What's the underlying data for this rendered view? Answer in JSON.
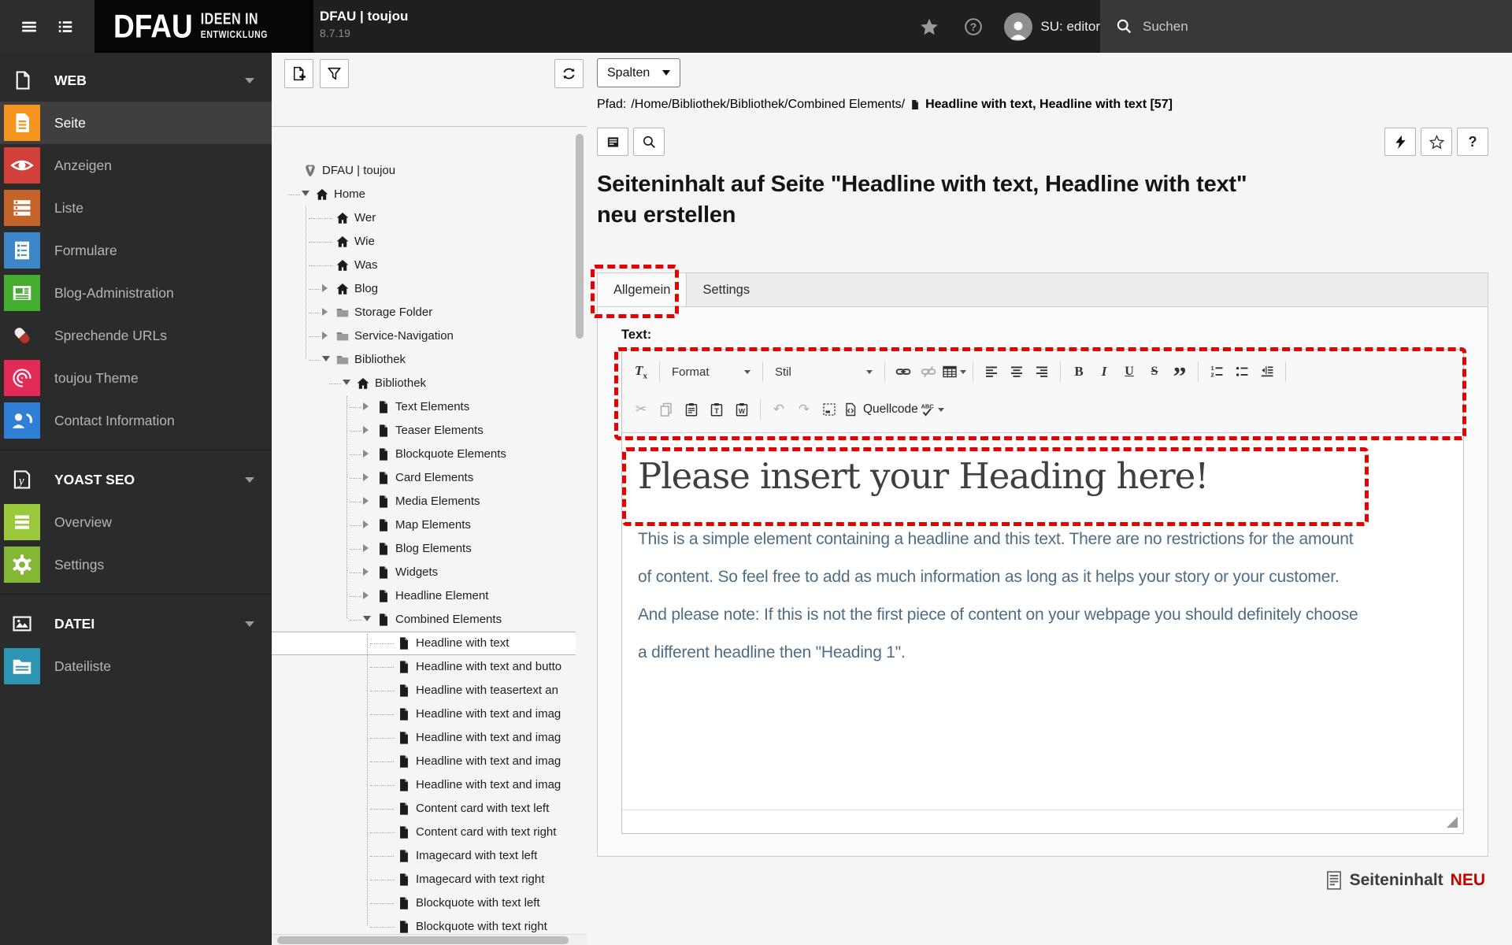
{
  "colors": {
    "annotation": "#e60000",
    "topbar_bg": "#1f1f1f",
    "sidebar_bg": "#2b2b2b",
    "rte_text_blue": "#4e6d87",
    "neu_red": "#c20000"
  },
  "topbar": {
    "logo_main": "DFAU",
    "logo_sub1": "IDEEN IN",
    "logo_sub2": "ENTWICKLUNG",
    "site_title": "DFAU | toujou",
    "version": "8.7.19",
    "username": "SU: editor",
    "search_label": "Suchen"
  },
  "sidebar": {
    "sections": [
      {
        "header": {
          "label": "WEB",
          "icon": "doc-outline"
        },
        "items": [
          {
            "label": "Seite",
            "icon": "mod-seite",
            "color": "#f7941d",
            "selected": true
          },
          {
            "label": "Anzeigen",
            "icon": "mod-eye",
            "color": "#d2403a"
          },
          {
            "label": "Liste",
            "icon": "mod-liste",
            "color": "#c4632a"
          },
          {
            "label": "Formulare",
            "icon": "mod-form",
            "color": "#3d87c8"
          },
          {
            "label": "Blog-Administration",
            "icon": "mod-news",
            "color": "#44ad2f"
          },
          {
            "label": "Sprechende URLs",
            "icon": "mod-pill",
            "color": ""
          },
          {
            "label": "toujou Theme",
            "icon": "mod-fingerprint",
            "color": "#e22b57"
          },
          {
            "label": "Contact Information",
            "icon": "mod-contact",
            "color": "#2f7fd6"
          }
        ]
      },
      {
        "header": {
          "label": "YOAST SEO",
          "icon": "mod-yoast"
        },
        "items": [
          {
            "label": "Overview",
            "icon": "mod-bars",
            "color": "#9aca3c"
          },
          {
            "label": "Settings",
            "icon": "mod-gear",
            "color": "#83b735"
          }
        ]
      },
      {
        "header": {
          "label": "DATEI",
          "icon": "image-outline"
        },
        "items": [
          {
            "label": "Dateiliste",
            "icon": "mod-files",
            "color": "#2e94b4"
          }
        ]
      }
    ]
  },
  "pagetree": {
    "nodes": [
      {
        "label": "DFAU | toujou",
        "level": 0,
        "icon": "typo3",
        "exp": null
      },
      {
        "label": "Home",
        "level": 1,
        "icon": "home",
        "exp": "down"
      },
      {
        "label": "Wer",
        "level": 2,
        "icon": "home",
        "exp": null
      },
      {
        "label": "Wie",
        "level": 2,
        "icon": "home",
        "exp": null
      },
      {
        "label": "Was",
        "level": 2,
        "icon": "home",
        "exp": null
      },
      {
        "label": "Blog",
        "level": 2,
        "icon": "home",
        "exp": "right"
      },
      {
        "label": "Storage Folder",
        "level": 2,
        "icon": "folder",
        "exp": "right"
      },
      {
        "label": "Service-Navigation",
        "level": 2,
        "icon": "folder",
        "exp": "right"
      },
      {
        "label": "Bibliothek",
        "level": 2,
        "icon": "folder",
        "exp": "down"
      },
      {
        "label": "Bibliothek",
        "level": 3,
        "icon": "home",
        "exp": "down"
      },
      {
        "label": "Text Elements",
        "level": 4,
        "icon": "page",
        "exp": "right"
      },
      {
        "label": "Teaser Elements",
        "level": 4,
        "icon": "page",
        "exp": "right"
      },
      {
        "label": "Blockquote Elements",
        "level": 4,
        "icon": "page",
        "exp": "right"
      },
      {
        "label": "Card Elements",
        "level": 4,
        "icon": "page",
        "exp": "right"
      },
      {
        "label": "Media Elements",
        "level": 4,
        "icon": "page",
        "exp": "right"
      },
      {
        "label": "Map Elements",
        "level": 4,
        "icon": "page",
        "exp": "right"
      },
      {
        "label": "Blog Elements",
        "level": 4,
        "icon": "page",
        "exp": "right"
      },
      {
        "label": "Widgets",
        "level": 4,
        "icon": "page",
        "exp": "right"
      },
      {
        "label": "Headline Element",
        "level": 4,
        "icon": "page",
        "exp": "right"
      },
      {
        "label": "Combined Elements",
        "level": 4,
        "icon": "page",
        "exp": "down"
      },
      {
        "label": "Headline with text",
        "level": 5,
        "icon": "page",
        "exp": null,
        "selected": true
      },
      {
        "label": "Headline with text and butto",
        "level": 5,
        "icon": "page",
        "exp": null
      },
      {
        "label": "Headline with teasertext an",
        "level": 5,
        "icon": "page",
        "exp": null
      },
      {
        "label": "Headline with text and imag",
        "level": 5,
        "icon": "page",
        "exp": null
      },
      {
        "label": "Headline with text and imag",
        "level": 5,
        "icon": "page",
        "exp": null
      },
      {
        "label": "Headline with text and imag",
        "level": 5,
        "icon": "page",
        "exp": null
      },
      {
        "label": "Headline with text and imag",
        "level": 5,
        "icon": "page",
        "exp": null
      },
      {
        "label": "Content card with text left",
        "level": 5,
        "icon": "page",
        "exp": null
      },
      {
        "label": "Content card with text right",
        "level": 5,
        "icon": "page",
        "exp": null
      },
      {
        "label": "Imagecard with text left",
        "level": 5,
        "icon": "page",
        "exp": null
      },
      {
        "label": "Imagecard with text right",
        "level": 5,
        "icon": "page",
        "exp": null
      },
      {
        "label": "Blockquote with text left",
        "level": 5,
        "icon": "page",
        "exp": null
      },
      {
        "label": "Blockquote with text right",
        "level": 5,
        "icon": "page",
        "exp": null
      }
    ]
  },
  "content": {
    "columns_select": {
      "value": "Spalten"
    },
    "path": {
      "prefix": "Pfad:",
      "path": "/Home/Bibliothek/Bibliothek/Combined Elements/",
      "record": "Headline with text, Headline with text [57]"
    },
    "title_line1": "Seiteninhalt auf Seite \"Headline with text, Headline with text\"",
    "title_line2": "neu erstellen",
    "tabs": [
      {
        "label": "Allgemein",
        "active": true
      },
      {
        "label": "Settings",
        "active": false
      }
    ],
    "form": {
      "field_label": "Text:"
    },
    "rte": {
      "toolbar_row1": [
        {
          "type": "tx",
          "icon": "remove-format-icon"
        },
        {
          "type": "sep"
        },
        {
          "type": "dropdown",
          "icon": "format-dropdown",
          "label": "Format",
          "width": 116
        },
        {
          "type": "sep"
        },
        {
          "type": "dropdown",
          "icon": "style-dropdown",
          "label": "Stil",
          "width": 140
        },
        {
          "type": "sep"
        },
        {
          "type": "svg",
          "icon": "link-icon"
        },
        {
          "type": "svg",
          "icon": "unlink-icon",
          "disabled": true
        },
        {
          "type": "svg",
          "icon": "table-icon",
          "caret": true
        },
        {
          "type": "sep"
        },
        {
          "type": "svg",
          "icon": "align-left-icon"
        },
        {
          "type": "svg",
          "icon": "align-center-icon"
        },
        {
          "type": "svg",
          "icon": "align-right-icon"
        },
        {
          "type": "sep"
        },
        {
          "type": "glyph",
          "icon": "bold-icon",
          "glyph": "B",
          "cls": "g-b"
        },
        {
          "type": "glyph",
          "icon": "italic-icon",
          "glyph": "I",
          "cls": "g-i"
        },
        {
          "type": "glyph",
          "icon": "underline-icon",
          "glyph": "U",
          "cls": "g-u"
        },
        {
          "type": "glyph",
          "icon": "strike-icon",
          "glyph": "S",
          "cls": "g-s"
        },
        {
          "type": "glyph",
          "icon": "blockquote-icon",
          "glyph": "”",
          "cls": "g-q"
        },
        {
          "type": "sep"
        },
        {
          "type": "svg",
          "icon": "ordered-list-icon"
        },
        {
          "type": "svg",
          "icon": "bullet-list-icon"
        },
        {
          "type": "svg",
          "icon": "indent-icon"
        },
        {
          "type": "sep"
        }
      ],
      "toolbar_row2": [
        {
          "type": "glyph",
          "icon": "cut-icon",
          "glyph": "✂",
          "cls": "g-generic",
          "disabled": true
        },
        {
          "type": "svg",
          "icon": "copy-icon",
          "disabled": true
        },
        {
          "type": "svg",
          "icon": "paste-icon"
        },
        {
          "type": "svg",
          "icon": "paste-text-icon"
        },
        {
          "type": "svg",
          "icon": "paste-word-icon"
        },
        {
          "type": "sep"
        },
        {
          "type": "glyph",
          "icon": "undo-icon",
          "glyph": "↶",
          "cls": "g-generic",
          "disabled": true
        },
        {
          "type": "glyph",
          "icon": "redo-icon",
          "glyph": "↷",
          "cls": "g-generic",
          "disabled": true
        },
        {
          "type": "svg",
          "icon": "select-all-icon"
        },
        {
          "type": "svg",
          "icon": "source-icon",
          "label": "Quellcode"
        },
        {
          "type": "svg",
          "icon": "spellcheck-icon",
          "caret": true
        }
      ],
      "heading": "Please insert your Heading here!",
      "paragraph_lines": [
        "This is a simple element containing a headline and this text. There are no restrictions for the amount",
        "of content. So feel free to add as much information as long as it helps your story or your customer.",
        "And please note: If this is not the first piece of content on your webpage you should definitely choose",
        "a different headline then \"Heading 1\"."
      ]
    },
    "footer": {
      "label": "Seiteninhalt",
      "badge": "NEU"
    }
  }
}
